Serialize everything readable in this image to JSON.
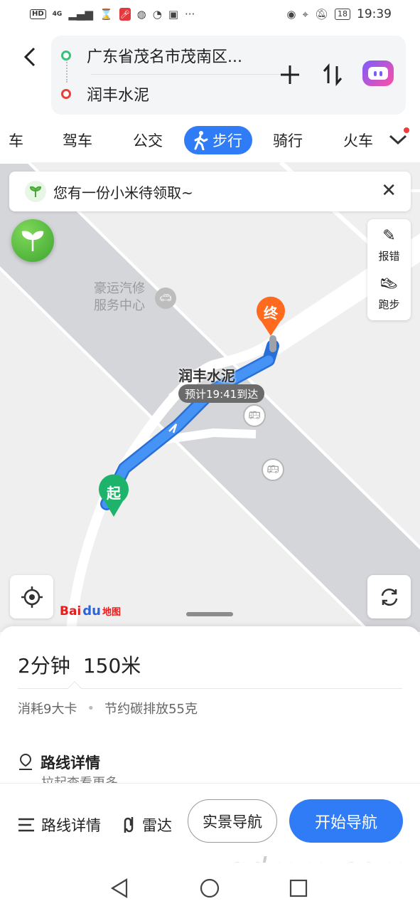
{
  "status_bar": {
    "left": {
      "hd": "HD",
      "net": "4G"
    },
    "right": {
      "battery": "18",
      "time": "19:39"
    }
  },
  "header": {
    "start": "广东省茂名市茂南区...",
    "end": "润丰水泥"
  },
  "tabs": [
    {
      "label": "车",
      "active": false
    },
    {
      "label": "驾车",
      "active": false
    },
    {
      "label": "公交",
      "active": false
    },
    {
      "label": "步行",
      "active": true
    },
    {
      "label": "骑行",
      "active": false
    },
    {
      "label": "火车",
      "active": false
    }
  ],
  "map": {
    "banner": "您有一份小米待领取~",
    "tools": [
      {
        "label": "报错",
        "icon": "edit-icon"
      },
      {
        "label": "跑步",
        "icon": "shoe-icon"
      }
    ],
    "poi": {
      "line1": "豪运汽修",
      "line2": "服务中心"
    },
    "destination_name": "润丰水泥",
    "eta": "预计19:41到达",
    "end_marker": "终",
    "start_marker": "起",
    "logo": {
      "brand": "Bai",
      "paw": "du",
      "word": "地图"
    }
  },
  "summary": {
    "duration": "2分钟",
    "distance": "150米",
    "calories": "消耗9大卡",
    "carbon": "节约碳排放55克"
  },
  "details": {
    "title": "路线详情",
    "subtitle": "拉起查看更多"
  },
  "actions": {
    "route_detail": "路线详情",
    "radar": "雷达",
    "ar_nav": "实景导航",
    "start_nav": "开始导航"
  },
  "watermark": "gdmm.com",
  "colors": {
    "accent": "#2f7cf6",
    "route": "#3a86f0",
    "start_marker": "#1db36b",
    "end_marker": "#ff6a1f"
  }
}
